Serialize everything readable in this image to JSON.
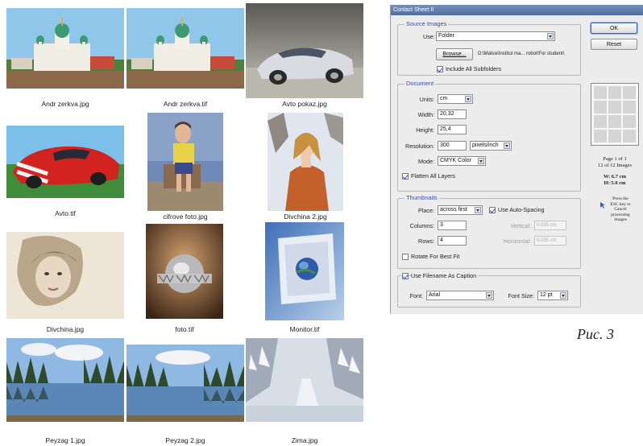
{
  "contact_sheet": {
    "thumbnails": [
      {
        "caption": "Andr zerkva.jpg",
        "kind": "church"
      },
      {
        "caption": "Andr zerkva.tif",
        "kind": "church"
      },
      {
        "caption": "Avto pokaz.jpg",
        "kind": "silver-car"
      },
      {
        "caption": "Avto.tif",
        "kind": "red-car"
      },
      {
        "caption": "cifrove foto.jpg",
        "kind": "child-photo"
      },
      {
        "caption": "Divchina 2.jpg",
        "kind": "woman-snow"
      },
      {
        "caption": "Divchina.jpg",
        "kind": "woman-portrait"
      },
      {
        "caption": "foto.tif",
        "kind": "www-globe"
      },
      {
        "caption": "Monitor.tif",
        "kind": "monitor-globe"
      },
      {
        "caption": "Peyzag 1.jpg",
        "kind": "lake-forest"
      },
      {
        "caption": "Peyzag 2.jpg",
        "kind": "lake-forest"
      },
      {
        "caption": "Zima.jpg",
        "kind": "winter-road"
      }
    ]
  },
  "dialog": {
    "title": "Contact Sheet II",
    "ok_label": "OK",
    "reset_label": "Reset",
    "source_images": {
      "legend": "Source Images",
      "use_label": "Use:",
      "use_value": "Folder",
      "browse_label": "Browse...",
      "path": "D:\\Matva\\Institut ma... robot\\For student\\",
      "include_subfolders_label": "Include All Subfolders",
      "include_subfolders": true
    },
    "document": {
      "legend": "Document",
      "units_label": "Units:",
      "units_value": "cm",
      "width_label": "Width:",
      "width_value": "20,32",
      "height_label": "Height:",
      "height_value": "25,4",
      "resolution_label": "Resolution:",
      "resolution_value": "300",
      "resolution_unit": "pixels/inch",
      "mode_label": "Mode:",
      "mode_value": "CMYK Color",
      "flatten_label": "Flatten All Layers",
      "flatten": true
    },
    "thumbnails": {
      "legend": "Thumbnails",
      "place_label": "Place:",
      "place_value": "across first",
      "auto_spacing_label": "Use Auto-Spacing",
      "auto_spacing": true,
      "columns_label": "Columns:",
      "columns_value": "3",
      "rows_label": "Rows:",
      "rows_value": "4",
      "vertical_label": "Vertical:",
      "vertical_value": "0,035 cm",
      "horizontal_label": "Horizontal:",
      "horizontal_value": "0,035 cm",
      "rotate_label": "Rotate For Best Fit",
      "rotate": false
    },
    "caption": {
      "use_filename_label": "Use Filename As Caption",
      "use_filename": true,
      "font_label": "Font:",
      "font_value": "Arial",
      "font_size_label": "Font Size:",
      "font_size_value": "12 pt"
    },
    "preview": {
      "page_info": "Page 1 of 1",
      "images_info": "12 of 12 Images",
      "w_info": "W: 6.7 cm",
      "h_info": "H: 5.0 cm",
      "esc_hint": "Press the ESC key to Cancel processing images"
    }
  },
  "figure_caption": "Рис. 3"
}
